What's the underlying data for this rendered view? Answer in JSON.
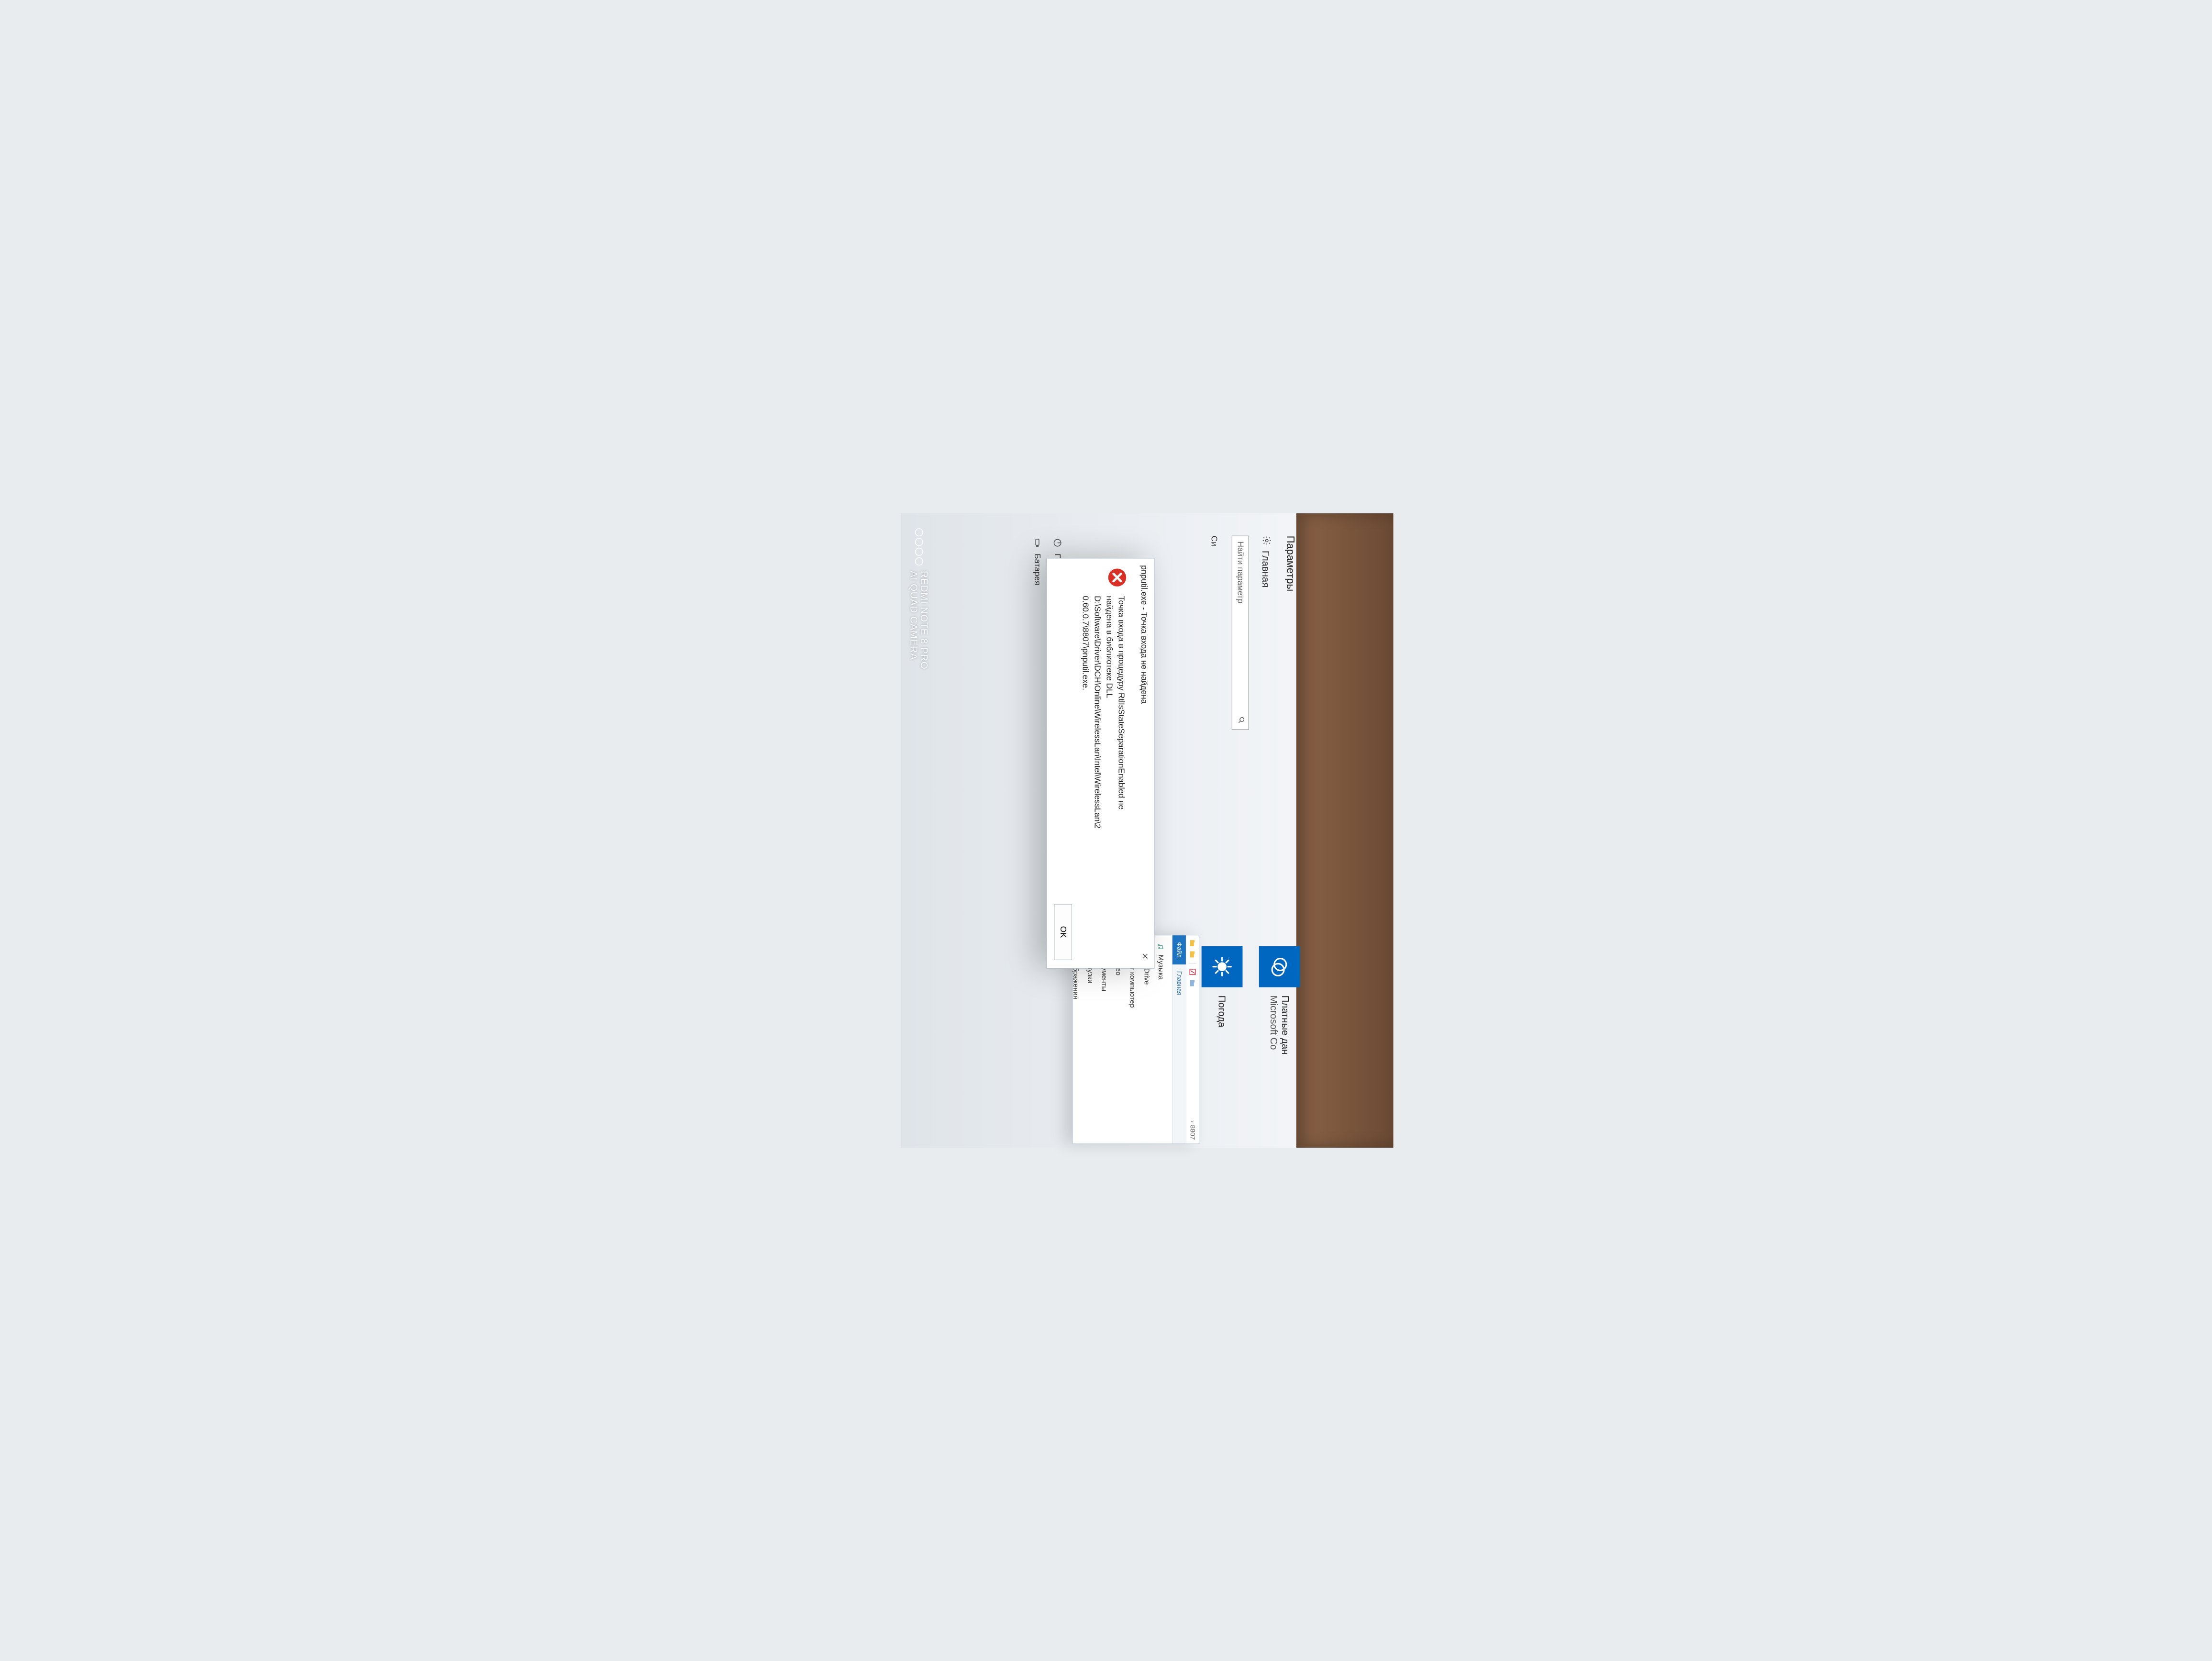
{
  "settings": {
    "window_title": "Параметры",
    "home_label": "Главная",
    "search_placeholder": "Найти параметр",
    "menu": [
      {
        "label": "Система",
        "active": false
      },
      {
        "label": "Питание и спящий режим",
        "active": false
      },
      {
        "label": "Батарея",
        "active": false
      }
    ],
    "truncated_left_item": "Си"
  },
  "tiles": [
    {
      "title_line1": "Платные дан",
      "title_line2": "Microsoft Co",
      "icon": "payment"
    },
    {
      "title_line1": "Погода",
      "title_line2": "",
      "icon": "weather"
    }
  ],
  "explorer": {
    "breadcrumb_current": "8807",
    "tab_file": "Файл",
    "tab_main": "Главная",
    "nav": [
      {
        "label": "Музыка",
        "icon": "music"
      },
      {
        "label": "OneDrive",
        "icon": "onedrive"
      },
      {
        "label": "Этот компьютер",
        "icon": "thispc"
      },
      {
        "label": "Видео",
        "icon": "video"
      },
      {
        "label": "Документы",
        "icon": "documents"
      },
      {
        "label": "Загрузки",
        "icon": "downloads"
      },
      {
        "label": "Изображения",
        "icon": "images"
      }
    ]
  },
  "dialog": {
    "title": "pnputil.exe - Точка входа не найдена",
    "message_line1": "Точка входа в процедуру RtlIsStateSeparationEnabled не",
    "message_line2": "найдена в библиотеке DLL",
    "message_line3": "D:\\Software\\Driver\\DCH\\Online\\WirelessLan\\Intel\\WirelessLan\\2",
    "message_line4": "0.60.0.7\\8807\\pnputil.exe.",
    "ok_label": "OK"
  },
  "watermark": {
    "line1": "REDMI NOTE 8 PRO",
    "line2": "AI QUAD CAMERA"
  }
}
